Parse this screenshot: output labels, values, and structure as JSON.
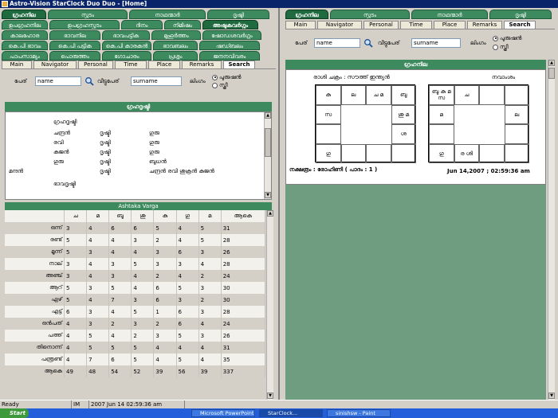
{
  "title": "Astro-Vision StarClock Duo Duo - [Home]",
  "left": {
    "tabs1": [
      "ഗ്രഹനില",
      "സ്ഫുടം",
      "നാഥന്മാർ",
      "ദൃഷ്ടി"
    ],
    "tabs2": [
      "ഉപഗ്രഹനില",
      "ഉപഗ്രഹസ്ഫുടം",
      "ദിനം",
      "നിമിഷം",
      "അഷ്ടകവർഗ്ഗം"
    ],
    "tabs3": [
      "കാലഹോര",
      "ഭാവനില",
      "ഭാവപട്ടിക",
      "മുഹൂർത്തം",
      "ഷോഡശവർഗ്ഗം"
    ],
    "tabs4": [
      "കെ.പി ഭാവം",
      "കെ.പി പട്ടിക",
      "കെ.പി കാരകൻ",
      "ഭാവബലം",
      "ഷഡ്ബലം"
    ],
    "tabs5": [
      "പാപസാമ്യം",
      "പൊരുത്തം",
      "ഗോചാരം",
      "പ്രശ്നം",
      "ജനനവിവരം"
    ],
    "subtabs": [
      "Main",
      "Navigator",
      "Personal",
      "Time",
      "Place",
      "Remarks",
      "Search"
    ],
    "form": {
      "name_label": "പേര്",
      "name_value": "name",
      "surname_label": "വീട്ടുപേര്",
      "surname_value": "surname",
      "gender_label": "ലിംഗം",
      "male": "പുരുഷൻ",
      "female": "സ്ത്രീ"
    },
    "aspect_title": "ഗ്രഹദൃഷ്ടി",
    "aspect_box_title": "ഗ്രഹദൃഷ്ടി",
    "aspects": [
      [
        "ചന്ദ്രൻ",
        "ദൃഷ്ടി",
        "ഗുരു",
        ""
      ],
      [
        "രവി",
        "ദൃഷ്ടി",
        "ഗുരു",
        ""
      ],
      [
        "കുജൻ",
        "ദൃഷ്ടി",
        "ഗുരു",
        ""
      ],
      [
        "ഗുരു",
        "ദൃഷ്ടി",
        "ബുധൻ",
        ""
      ],
      [
        "",
        "ദൃഷ്ടി",
        "ചന്ദ്രൻ രവി ശുക്രൻ കുജൻ",
        ""
      ]
    ],
    "aspect_row5_label": "മന്ദൻ",
    "bhava_label": "ഭാവദൃഷ്ടി",
    "ashtaka": {
      "title": "Ashtaka Varga",
      "cols": [
        "",
        "ച",
        "മ",
        "ബു",
        "ശു",
        "കു",
        "ഗു",
        "മ",
        "ആകെ"
      ],
      "rows": [
        [
          "ഒന്ന്",
          "3",
          "4",
          "6",
          "6",
          "5",
          "4",
          "5",
          "31"
        ],
        [
          "രണ്ട്",
          "5",
          "4",
          "4",
          "3",
          "2",
          "4",
          "5",
          "28"
        ],
        [
          "മൂന്ന്",
          "5",
          "3",
          "4",
          "4",
          "3",
          "6",
          "3",
          "26"
        ],
        [
          "നാല്",
          "3",
          "4",
          "3",
          "5",
          "3",
          "3",
          "4",
          "28"
        ],
        [
          "അഞ്ച്",
          "3",
          "4",
          "3",
          "4",
          "2",
          "4",
          "2",
          "24"
        ],
        [
          "ആറ്",
          "5",
          "3",
          "5",
          "4",
          "6",
          "5",
          "3",
          "30"
        ],
        [
          "ഏഴ്",
          "5",
          "4",
          "7",
          "3",
          "6",
          "3",
          "2",
          "30"
        ],
        [
          "എട്ട്",
          "6",
          "3",
          "4",
          "5",
          "1",
          "6",
          "3",
          "28"
        ],
        [
          "ഒൻപത്",
          "4",
          "3",
          "2",
          "3",
          "2",
          "6",
          "4",
          "24"
        ],
        [
          "പത്ത്",
          "4",
          "5",
          "4",
          "2",
          "3",
          "5",
          "3",
          "26"
        ],
        [
          "തിനൊന്ന്",
          "4",
          "5",
          "5",
          "5",
          "4",
          "4",
          "4",
          "31"
        ],
        [
          "പന്ത്രണ്ട്",
          "4",
          "7",
          "6",
          "5",
          "4",
          "5",
          "4",
          "35"
        ],
        [
          "ആകെ",
          "49",
          "48",
          "54",
          "52",
          "39",
          "56",
          "39",
          "337"
        ]
      ]
    }
  },
  "right": {
    "tabs1": [
      "ഗ്രഹനില",
      "സ്ഫുടം",
      "നാഥന്മാർ",
      "ദൃഷ്ടി"
    ],
    "subtabs": [
      "Main",
      "Navigator",
      "Personal",
      "Time",
      "Place",
      "Remarks",
      "Search"
    ],
    "form": {
      "name_label": "പേര്",
      "name_value": "name",
      "surname_label": "വീട്ടുപേര്",
      "surname_value": "surname",
      "gender_label": "ലിംഗം",
      "male": "പുരുഷൻ",
      "female": "സ്ത്രീ"
    },
    "panel_title": "ഗ്രഹനില",
    "rasi_title": "രാശി ചക്രം : സൗത്ത് ഇന്ത്യൻ",
    "navamsa_title": "നവാംശം",
    "rasi_cells": {
      "c0": "കു",
      "c1": "ല",
      "c2": "ച\nമ",
      "c3": "ബു",
      "c4": "സ",
      "c7": "ശു മ",
      "c8": "",
      "c9": "ശ",
      "c10": "ഗു",
      "c11": ""
    },
    "nav_cells": {
      "c0": "ബു കു\nമ സ",
      "c1": "ച",
      "c4": "മ",
      "c7": "ല",
      "c10": "ഗു",
      "c11": "ര ശി"
    },
    "nakshatra": "നക്ഷത്രം : രോഹിണി ( പാദം : 1 )",
    "datetime": "Jun 14,2007 ; 02:59:36 am"
  },
  "status": {
    "ready": "Ready",
    "im": "IM",
    "time": "2007 Jun 14 02:59:36 am"
  },
  "taskbar": {
    "start": "Start",
    "items": [
      "Microsoft PowerPoint ...",
      "StarClock...",
      "sinishsw - Paint"
    ]
  }
}
